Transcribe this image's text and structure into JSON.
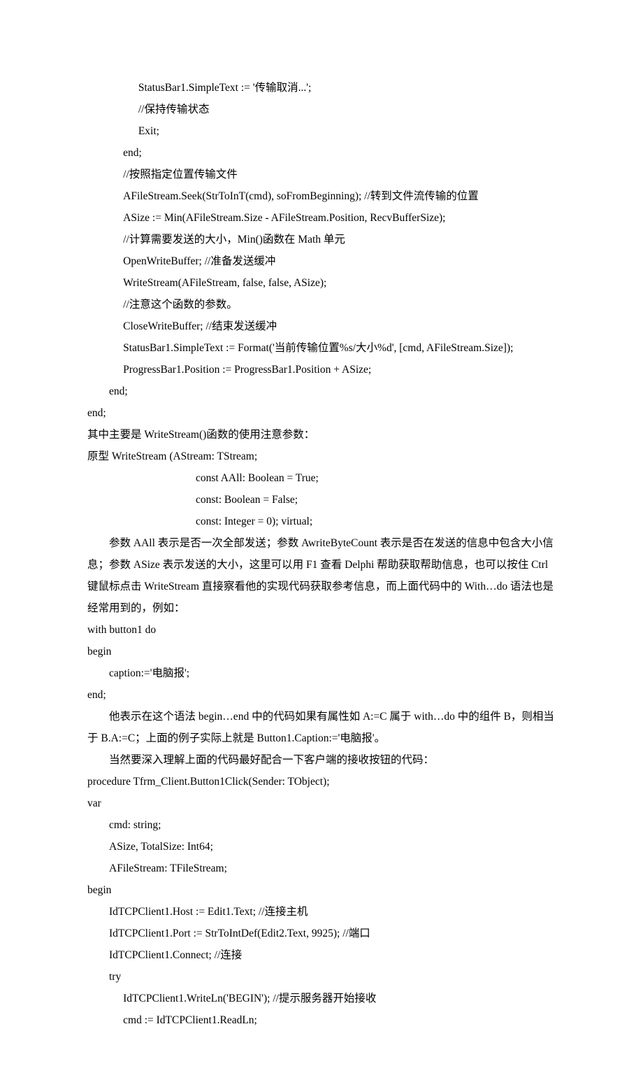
{
  "lines": [
    {
      "cls": "line i3",
      "key": "l01",
      "text": "StatusBar1.SimpleText := '传输取消...';"
    },
    {
      "cls": "line i3",
      "key": "l02",
      "text": "//保持传输状态"
    },
    {
      "cls": "line i3",
      "key": "l03",
      "text": "Exit;"
    },
    {
      "cls": "line i2",
      "key": "l04",
      "text": "end;"
    },
    {
      "cls": "line i2",
      "key": "l05",
      "text": "//按照指定位置传输文件"
    },
    {
      "cls": "line i2",
      "key": "l06",
      "text": "AFileStream.Seek(StrToInT(cmd), soFromBeginning); //转到文件流传输的位置"
    },
    {
      "cls": "line i2",
      "key": "l07",
      "text": "ASize := Min(AFileStream.Size - AFileStream.Position, RecvBufferSize);"
    },
    {
      "cls": "line i2",
      "key": "l08",
      "text": "//计算需要发送的大小，Min()函数在 Math 单元"
    },
    {
      "cls": "line i2",
      "key": "l09",
      "text": "OpenWriteBuffer; //准备发送缓冲"
    },
    {
      "cls": "line i2",
      "key": "l10",
      "text": "WriteStream(AFileStream, false, false, ASize);"
    },
    {
      "cls": "line i2",
      "key": "l11",
      "text": "//注意这个函数的参数。"
    },
    {
      "cls": "line i2",
      "key": "l12",
      "text": "CloseWriteBuffer; //结束发送缓冲"
    },
    {
      "cls": "line i2",
      "key": "l13",
      "text": "StatusBar1.SimpleText := Format('当前传输位置%s/大小%d', [cmd, AFileStream.Size]);"
    },
    {
      "cls": "line i2",
      "key": "l14",
      "text": "ProgressBar1.Position := ProgressBar1.Position + ASize;"
    },
    {
      "cls": "line i1",
      "key": "l15",
      "text": "end;"
    },
    {
      "cls": "line",
      "key": "l16",
      "text": "end;"
    },
    {
      "cls": "line",
      "key": "l17",
      "text": "其中主要是 WriteStream()函数的使用注意参数："
    },
    {
      "cls": "line",
      "key": "l18",
      "text": "原型 WriteStream (AStream: TStream;"
    },
    {
      "cls": "line i4",
      "key": "l19",
      "text": "const AAll: Boolean = True;"
    },
    {
      "cls": "line i4",
      "key": "l20",
      "text": "const: Boolean = False;"
    },
    {
      "cls": "line i4",
      "key": "l21",
      "text": "const: Integer = 0); virtual;"
    },
    {
      "cls": "para",
      "key": "l22",
      "text": "参数 AAll 表示是否一次全部发送；参数 AwriteByteCount 表示是否在发送的信息中包含大小信息；参数 ASize 表示发送的大小，这里可以用 F1 查看 Delphi 帮助获取帮助信息，也可以按住 Ctrl 键鼠标点击 WriteStream 直接察看他的实现代码获取参考信息，而上面代码中的 With…do 语法也是经常用到的，例如："
    },
    {
      "cls": "line",
      "key": "l23",
      "text": "with button1 do"
    },
    {
      "cls": "line",
      "key": "l24",
      "text": "begin"
    },
    {
      "cls": "line i1",
      "key": "l25",
      "text": "caption:='电脑报';"
    },
    {
      "cls": "line",
      "key": "l26",
      "text": "end;"
    },
    {
      "cls": "para",
      "key": "l27",
      "text": "他表示在这个语法 begin…end 中的代码如果有属性如 A:=C 属于 with…do 中的组件 B，则相当于 B.A:=C；上面的例子实际上就是 Button1.Caption:='电脑报'。"
    },
    {
      "cls": "para",
      "key": "l28",
      "text": "当然要深入理解上面的代码最好配合一下客户端的接收按钮的代码："
    },
    {
      "cls": "line",
      "key": "l29",
      "text": "procedure Tfrm_Client.Button1Click(Sender: TObject);"
    },
    {
      "cls": "line",
      "key": "l30",
      "text": "var"
    },
    {
      "cls": "line i1",
      "key": "l31",
      "text": "cmd: string;"
    },
    {
      "cls": "line i1",
      "key": "l32",
      "text": "ASize, TotalSize: Int64;"
    },
    {
      "cls": "line i1",
      "key": "l33",
      "text": "AFileStream: TFileStream;"
    },
    {
      "cls": "line",
      "key": "l34",
      "text": "begin"
    },
    {
      "cls": "line i1",
      "key": "l35",
      "text": "IdTCPClient1.Host := Edit1.Text; //连接主机"
    },
    {
      "cls": "line i1",
      "key": "l36",
      "text": "IdTCPClient1.Port := StrToIntDef(Edit2.Text, 9925); //端口"
    },
    {
      "cls": "line i1",
      "key": "l37",
      "text": "IdTCPClient1.Connect; //连接"
    },
    {
      "cls": "line i1",
      "key": "l38",
      "text": "try"
    },
    {
      "cls": "line i2",
      "key": "l39",
      "text": "IdTCPClient1.WriteLn('BEGIN'); //提示服务器开始接收"
    },
    {
      "cls": "line i2",
      "key": "l40",
      "text": "cmd := IdTCPClient1.ReadLn;"
    }
  ]
}
